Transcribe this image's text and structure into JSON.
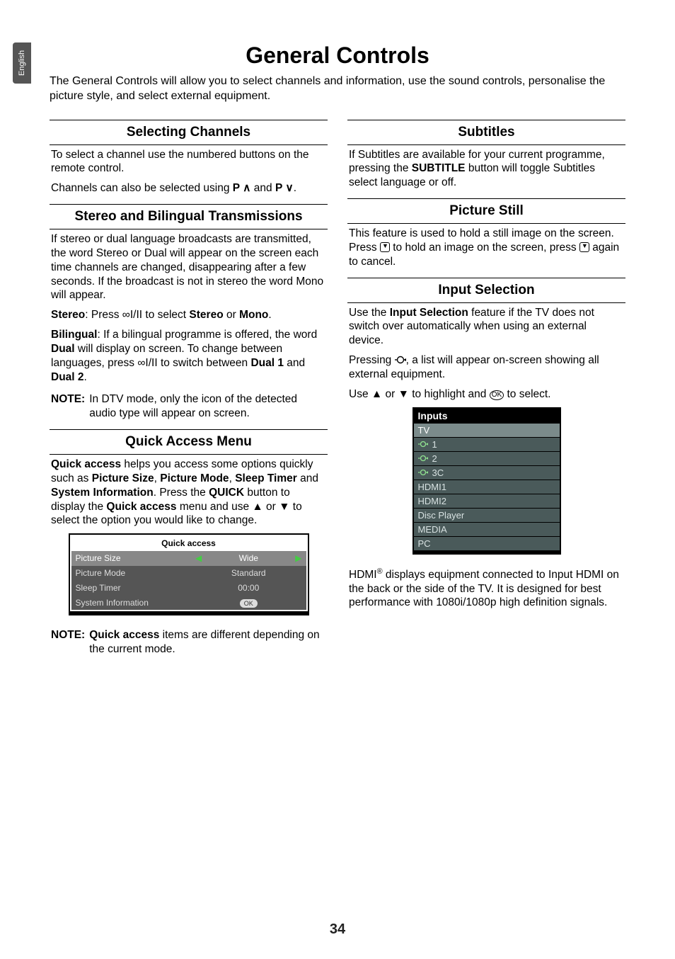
{
  "language_tab": "English",
  "title": "General Controls",
  "intro": "The General Controls will allow you to select channels and information, use the sound controls, personalise the picture style, and select external equipment.",
  "page_number": "34",
  "left": {
    "selecting_channels": {
      "heading": "Selecting Channels",
      "p1": "To select a channel use the numbered buttons on the remote control.",
      "p2_a": "Channels can also be selected using ",
      "p2_b": " and ",
      "p2_c": "."
    },
    "stereo": {
      "heading": "Stereo and Bilingual Transmissions",
      "p1": "If stereo or dual language broadcasts are transmitted, the word Stereo or Dual will appear on the screen each time channels are changed, disappearing after a few seconds. If the broadcast is not in stereo the word Mono will appear.",
      "p2_label": "Stereo",
      "p2_a": ": Press ",
      "p2_b": " to select ",
      "p2_c": " or ",
      "p2_stereo": "Stereo",
      "p2_mono": "Mono",
      "p2_d": ".",
      "p3_label": "Bilingual",
      "p3_a": ": If a bilingual programme is offered, the word ",
      "p3_dual": "Dual",
      "p3_b": " will display on screen. To change between languages, press ",
      "p3_c": " to switch between ",
      "p3_d1": "Dual 1",
      "p3_and": " and ",
      "p3_d2": "Dual 2",
      "p3_e": ".",
      "note_label": "NOTE:",
      "note": "In DTV mode, only the icon of the detected audio type will appear on screen."
    },
    "quick": {
      "heading": "Quick Access Menu",
      "p_a": "Quick access",
      "p_b": " helps you access some options quickly such as ",
      "p_c": "Picture Size",
      "p_d": ", ",
      "p_e": "Picture Mode",
      "p_f": ", ",
      "p_g": "Sleep Timer",
      "p_h": " and ",
      "p_i": "System Information",
      "p_j": ". Press the ",
      "p_k": "QUICK",
      "p_l": " button to display the ",
      "p_m": "Quick access",
      "p_n": " menu and use ▲ or ▼ to select the option you would like to change.",
      "menu_title": "Quick access",
      "rows": [
        {
          "label": "Picture Size",
          "value": "Wide",
          "selected": true,
          "arrows": true
        },
        {
          "label": "Picture Mode",
          "value": "Standard"
        },
        {
          "label": "Sleep Timer",
          "value": "00:00"
        },
        {
          "label": "System Information",
          "value": "",
          "ok": true
        }
      ],
      "note_label": "NOTE:",
      "note_a": "Quick access",
      "note_b": " items are different depending on the current mode."
    }
  },
  "right": {
    "subtitles": {
      "heading": "Subtitles",
      "p_a": "If Subtitles are available for your current programme, pressing the ",
      "p_b": "SUBTITLE",
      "p_c": " button will toggle Subtitles select language or off."
    },
    "still": {
      "heading": "Picture Still",
      "p_a": "This feature is used to hold a still image on the screen. Press ",
      "p_b": " to hold an image on the screen, press ",
      "p_c": " again to cancel."
    },
    "input": {
      "heading": "Input Selection",
      "p1_a": "Use the ",
      "p1_b": "Input Selection",
      "p1_c": " feature if the TV does not switch over automatically when using an external device.",
      "p2_a": "Pressing ",
      "p2_b": ", a list will appear on-screen showing all external equipment.",
      "p3": "Use ▲ or ▼ to highlight and ",
      "p3_b": " to select.",
      "list_title": "Inputs",
      "rows": [
        {
          "label": "TV",
          "selected": true,
          "icon": false
        },
        {
          "label": "1",
          "icon": true
        },
        {
          "label": "2",
          "icon": true
        },
        {
          "label": "3C",
          "icon": true
        },
        {
          "label": "HDMI1",
          "icon": false
        },
        {
          "label": "HDMI2",
          "icon": false
        },
        {
          "label": "Disc Player",
          "icon": false
        },
        {
          "label": "MEDIA",
          "icon": false
        },
        {
          "label": "PC",
          "icon": false
        }
      ],
      "p4": "HDMI® displays equipment connected to Input HDMI on the back or the side of the TV. It is designed for best performance with 1080i/1080p high definition signals."
    }
  }
}
